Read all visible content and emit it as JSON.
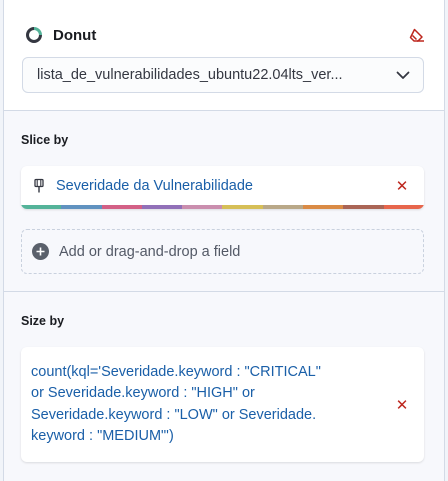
{
  "header": {
    "title": "Donut",
    "icons": {
      "chart": "donut-chart-icon",
      "clear": "eraser-icon"
    },
    "data_view": {
      "selected": "lista_de_vulnerabilidades_ubuntu22.04lts_ver..."
    }
  },
  "slice_by": {
    "label": "Slice by",
    "field": {
      "name": "Severidade da Vulnerabilidade",
      "type_icon": "keyword-pin-icon"
    },
    "palette": [
      "#54b399",
      "#6092c0",
      "#d36086",
      "#9170b8",
      "#ca8eae",
      "#d6bf57",
      "#b9a888",
      "#da8b45",
      "#aa6556",
      "#e7664c"
    ],
    "add_field": "Add or drag-and-drop a field"
  },
  "size_by": {
    "label": "Size by",
    "formula": "count(kql='Severidade.keyword : \"CRITICAL\"\nor Severidade.keyword : \"HIGH\" or\nSeveridade.keyword : \"LOW\" or Severidade.\nkeyword : \"MEDIUM\"')"
  },
  "colors": {
    "accent_text": "#1a5fa8",
    "danger": "#bd271e",
    "border": "#d3dae6"
  }
}
